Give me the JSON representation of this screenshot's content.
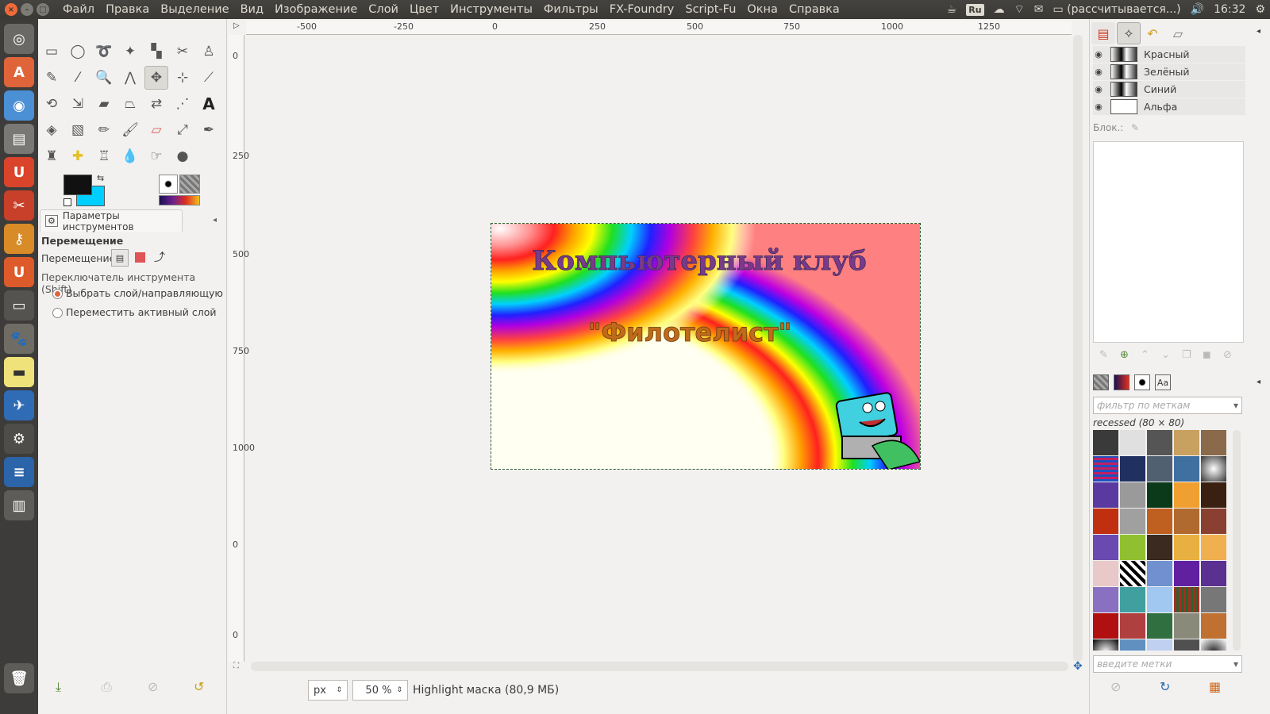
{
  "menubar": {
    "items": [
      "Файл",
      "Правка",
      "Выделение",
      "Вид",
      "Изображение",
      "Слой",
      "Цвет",
      "Инструменты",
      "Фильтры",
      "FX-Foundry",
      "Script-Fu",
      "Окна",
      "Справка"
    ],
    "keyboard_layout": "Ru",
    "battery_text": "(рассчитывается...)",
    "clock": "16:32"
  },
  "tool_options": {
    "tab_label": "Параметры инструментов",
    "tool_name": "Перемещение",
    "move_label": "Перемещение:",
    "switch_label": "Переключатель инструмента  (Shift)",
    "options": [
      "Выбрать слой/направляющую",
      "Переместить активный слой"
    ],
    "selected_option": "Выбрать слой/направляющую"
  },
  "rulers": {
    "horizontal": [
      "-500",
      "-250",
      "0",
      "250",
      "500",
      "750",
      "1000",
      "1250"
    ],
    "vertical": [
      "0",
      "250",
      "500",
      "750",
      "1000",
      "0",
      "0",
      "0"
    ]
  },
  "image": {
    "title_line1": "Компьютерный клуб",
    "title_line2": "\"Филотелист\""
  },
  "status": {
    "unit": "px",
    "zoom": "50 %",
    "message": "Highlight маска (80,9 МБ)"
  },
  "channels": {
    "rows": [
      "Красный",
      "Зелёный",
      "Синий",
      "Альфа"
    ],
    "lock_label": "Блок.:"
  },
  "patterns": {
    "filter_placeholder": "фильтр по меткам",
    "selected_pattern": "recessed (80 × 80)",
    "tags_placeholder": "введите метки"
  },
  "colors": {
    "foreground": "#111111",
    "background": "#00cfff",
    "accent": "#e0643a"
  }
}
